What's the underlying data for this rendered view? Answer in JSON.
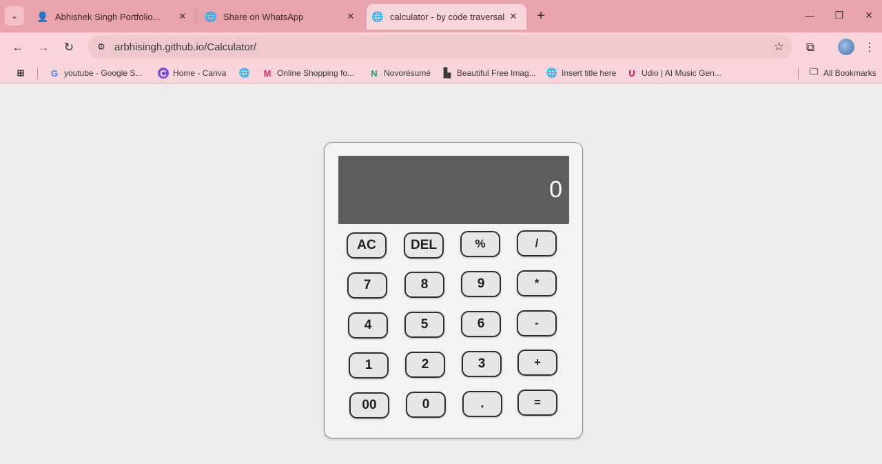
{
  "browser": {
    "tabs": [
      {
        "title": "Abhishek Singh Portfolio...",
        "active": false
      },
      {
        "title": "Share on WhatsApp",
        "active": false
      },
      {
        "title": "calculator - by code traversal",
        "active": true
      }
    ],
    "address": "arbhisingh.github.io/Calculator/",
    "bookmarks": [
      {
        "label": "youtube - Google S...",
        "icon": "G"
      },
      {
        "label": "Home - Canva",
        "icon": "C"
      },
      {
        "label": "",
        "icon": "🌐"
      },
      {
        "label": "Online Shopping fo...",
        "icon": "M"
      },
      {
        "label": "Novorésumé",
        "icon": "N"
      },
      {
        "label": "Beautiful Free Imag...",
        "icon": "▙"
      },
      {
        "label": "Insert title here",
        "icon": "🌐"
      },
      {
        "label": "Udio | AI Music Gen...",
        "icon": "U"
      }
    ],
    "all_bookmarks": "All Bookmarks"
  },
  "calculator": {
    "display": "0",
    "keys": [
      "AC",
      "DEL",
      "%",
      "/",
      "7",
      "8",
      "9",
      "*",
      "4",
      "5",
      "6",
      "-",
      "1",
      "2",
      "3",
      "+",
      "00",
      "0",
      ".",
      "="
    ]
  },
  "colors": {
    "tabstrip": "#e9a3ad",
    "toolbar": "#f7d5da",
    "display_bg": "#5b5e5d",
    "key_border": "#2e2e2e"
  }
}
